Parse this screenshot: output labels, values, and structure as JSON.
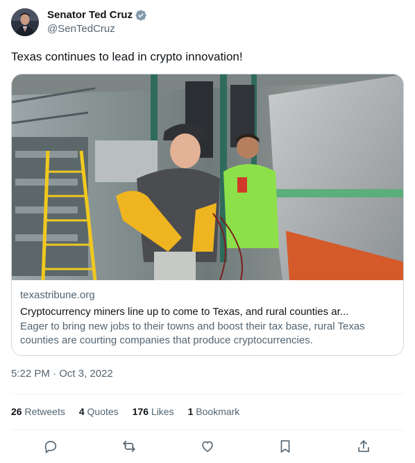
{
  "author": {
    "display_name": "Senator Ted Cruz",
    "handle": "@SenTedCruz",
    "verified_icon": "verified-badge-icon"
  },
  "tweet": {
    "text": "Texas continues to lead in crypto innovation!"
  },
  "card": {
    "domain": "texastribune.org",
    "title": "Cryptocurrency miners line up to come to Texas, and rural counties ar...",
    "description": "Eager to bring new jobs to their towns and boost their tax base, rural Texas counties are courting companies that produce cryptocurrencies."
  },
  "timestamp": "5:22 PM · Oct 3, 2022",
  "stats": {
    "retweets_count": "26",
    "retweets_label": "Retweets",
    "quotes_count": "4",
    "quotes_label": "Quotes",
    "likes_count": "176",
    "likes_label": "Likes",
    "bookmarks_count": "1",
    "bookmarks_label": "Bookmark"
  },
  "actions": [
    "reply-icon",
    "retweet-icon",
    "like-icon",
    "bookmark-icon",
    "share-icon"
  ],
  "colors": {
    "text_primary": "#0f1419",
    "text_secondary": "#536471",
    "border": "#cfd9de",
    "verified": "#829aab"
  }
}
